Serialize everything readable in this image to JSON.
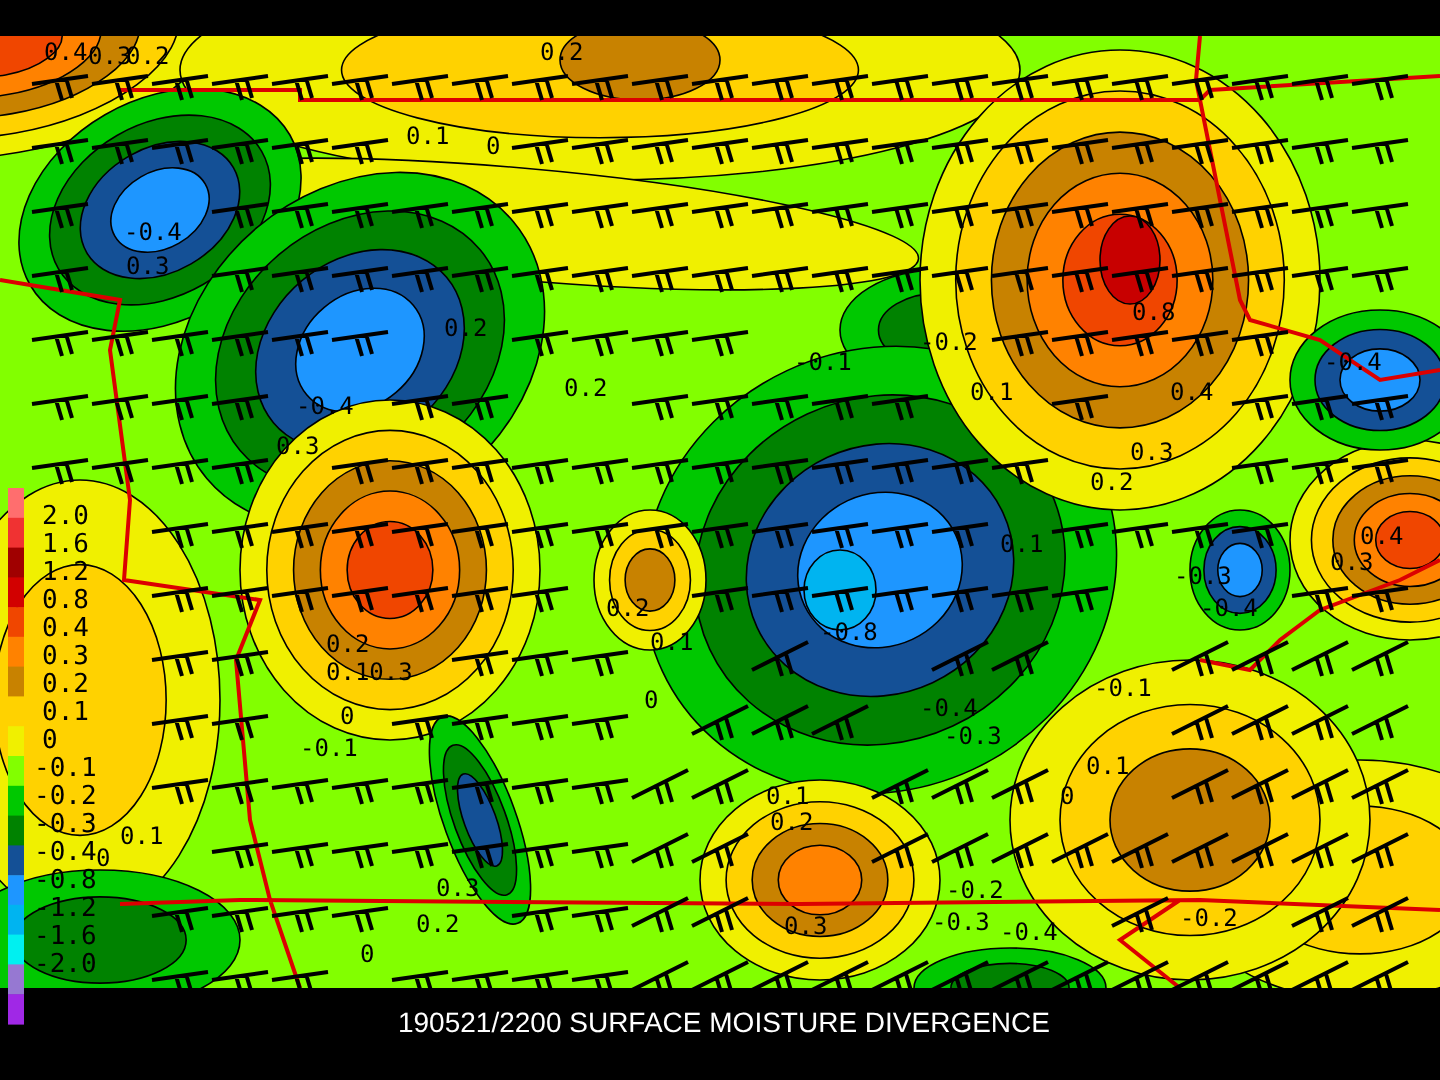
{
  "map": {
    "contour_labels": [
      "0.4",
      "0.3",
      "0.2",
      "0.2",
      "0.1",
      "0",
      "-0.4",
      "0.3",
      "0.8",
      "0.2",
      "-0.2",
      "-0.1",
      "-0.4",
      "0.2",
      "0.1",
      "0.4",
      "-0.4",
      "0.3",
      "0.3",
      "0.2",
      "0.1",
      "0.4",
      "0.3",
      "-0.3",
      "0.2",
      "-0.4",
      "-0.8",
      "0.2",
      "0.1",
      "0.10.3",
      "0",
      "0",
      "-0.1",
      "-0.4",
      "-0.1",
      "-0.3",
      "0.1",
      "0.1",
      "0",
      "0.2",
      "0.1",
      "0",
      "0.3",
      "-0.2",
      "0.2",
      "0.3",
      "-0.3",
      "-0.2",
      "-0.4",
      "0"
    ]
  },
  "legend": {
    "swatches": [
      {
        "color": "#ff6e6e"
      },
      {
        "color": "#f03232"
      },
      {
        "color": "#a00000"
      },
      {
        "color": "#d20000"
      },
      {
        "color": "#f04600"
      },
      {
        "color": "#ff8200"
      },
      {
        "color": "#c88200"
      },
      {
        "color": "#ffd200"
      },
      {
        "color": "#f0f000"
      },
      {
        "color": "#82ff00"
      },
      {
        "color": "#00c800"
      },
      {
        "color": "#008200"
      },
      {
        "color": "#145096"
      },
      {
        "color": "#1e96ff"
      },
      {
        "color": "#00b4f0"
      },
      {
        "color": "#00f0f0"
      },
      {
        "color": "#9678d2"
      },
      {
        "color": "#a028e6"
      }
    ],
    "labels": [
      "2.0",
      "1.6",
      "1.2",
      "0.8",
      "0.4",
      "0.3",
      "0.2",
      "0.1",
      "0",
      "-0.1",
      "-0.2",
      "-0.3",
      "-0.4",
      "-0.8",
      "-1.2",
      "-1.6",
      "-2.0"
    ]
  },
  "title": "190521/2200 SURFACE MOISTURE DIVERGENCE"
}
